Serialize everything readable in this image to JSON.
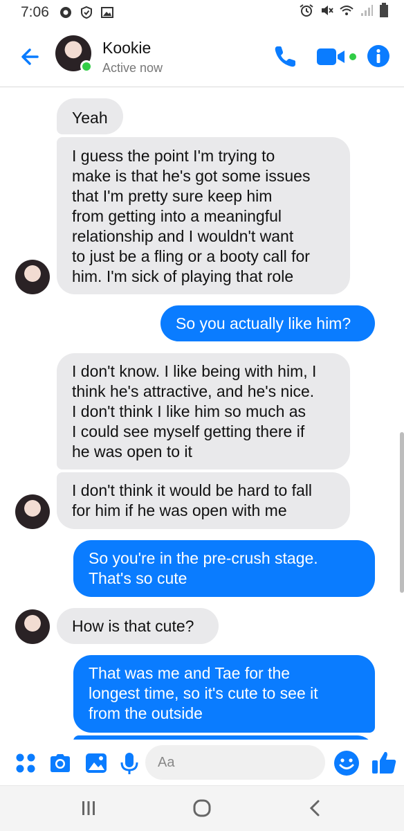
{
  "status_bar": {
    "time": "7:06"
  },
  "header": {
    "contact_name": "Kookie",
    "contact_status": "Active now"
  },
  "messages": [
    {
      "side": "in",
      "text": "Yeah"
    },
    {
      "side": "in",
      "lines": [
        "I guess the point I'm trying to",
        "make is that he's got some issues",
        "that I'm pretty sure keep him",
        "from getting into a meaningful",
        "relationship and I wouldn't want",
        "to just be a fling or a booty call for",
        "him. I'm sick of playing that role"
      ]
    },
    {
      "side": "out",
      "text": "So you actually like him?"
    },
    {
      "side": "in",
      "lines": [
        "I don't know. I like being with him, I",
        "think he's attractive, and he's nice.",
        "I don't think I like him so much as",
        "I could see myself getting there if",
        "he was open to it"
      ]
    },
    {
      "side": "in",
      "lines": [
        "I don't think it would be hard to fall",
        "for him if he was open with me"
      ]
    },
    {
      "side": "out",
      "lines": [
        "So you're in the pre-crush stage.",
        "That's so cute"
      ]
    },
    {
      "side": "in",
      "text": "How is that cute?"
    },
    {
      "side": "out",
      "lines": [
        "That was me and Tae for the",
        "longest time, so it's cute to see it",
        "from the outside"
      ]
    }
  ],
  "composer": {
    "placeholder": "Aa"
  },
  "colors": {
    "accent": "#0a7cff",
    "incoming_bubble": "#e9e9eb",
    "active": "#31cc46"
  },
  "icons": {
    "back": "arrow-left-icon",
    "call": "phone-icon",
    "video": "video-camera-icon",
    "info": "info-icon",
    "apps": "apps-grid-icon",
    "camera": "camera-icon",
    "gallery": "image-icon",
    "mic": "microphone-icon",
    "emoji": "emoji-icon",
    "like": "thumbs-up-icon"
  }
}
